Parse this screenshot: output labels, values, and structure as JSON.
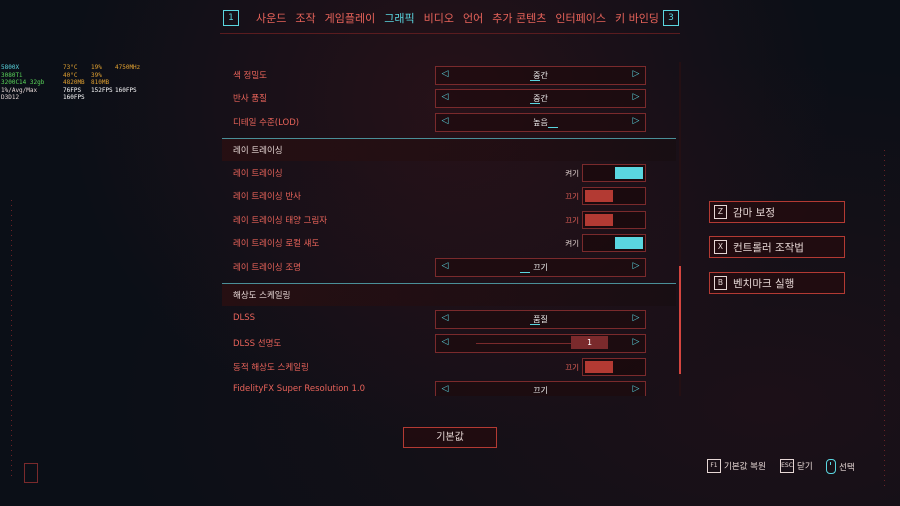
{
  "nav": {
    "left_key": "1",
    "right_key": "3",
    "tabs": [
      "사운드",
      "조작",
      "게임플레이",
      "그래픽",
      "비디오",
      "언어",
      "추가 콘텐츠",
      "인터페이스",
      "키 바인딩"
    ],
    "active_tab": "그래픽"
  },
  "perf_overlay": [
    [
      "5800X",
      "73°C",
      "19%",
      "4750MHz"
    ],
    [
      "3080Ti",
      "40°C",
      "39%",
      ""
    ],
    [
      "3200C14 32gb",
      "4820MB",
      "810MB",
      ""
    ],
    [
      "1%/Avg/Max",
      "76FPS",
      "152FPS",
      "160FPS"
    ],
    [
      "D3D12",
      "160FPS",
      "",
      ""
    ]
  ],
  "settings": {
    "color_precision": {
      "label": "색 정밀도",
      "value": "중간"
    },
    "reflection_quality": {
      "label": "반사 품질",
      "value": "중간"
    },
    "lod": {
      "label": "디테일 수준(LOD)",
      "value": "높음"
    },
    "rt_section": "레이 트레이싱",
    "rt": {
      "label": "레이 트레이싱",
      "state": "켜기"
    },
    "rt_reflections": {
      "label": "레이 트레이싱 반사",
      "state": "끄기"
    },
    "rt_sun_shadows": {
      "label": "레이 트레이싱 태양 그림자",
      "state": "끄기"
    },
    "rt_local_shadows": {
      "label": "레이 트레이싱 로컬 섀도",
      "state": "켜기"
    },
    "rt_lighting": {
      "label": "레이 트레이싱 조명",
      "value": "끄기"
    },
    "scaling_section": "해상도 스케일링",
    "dlss": {
      "label": "DLSS",
      "value": "품질"
    },
    "dlss_sharpness": {
      "label": "DLSS 선명도",
      "value": "1"
    },
    "dynamic_scaling": {
      "label": "동적 해상도 스케일링",
      "state": "끄기"
    },
    "fsr": {
      "label": "FidelityFX Super Resolution 1.0",
      "value": "끄기"
    }
  },
  "side_buttons": [
    {
      "key": "Z",
      "label": "감마 보정"
    },
    {
      "key": "X",
      "label": "컨트롤러 조작법"
    },
    {
      "key": "B",
      "label": "벤치마크 실행"
    }
  ],
  "default_button": "기본값",
  "hints": {
    "reset_key": "F1",
    "reset_label": "기본값 복원",
    "close_key": "ESC",
    "close_label": "닫기",
    "select_label": "선택"
  },
  "colors": {
    "accent_cyan": "#5ad6e0",
    "accent_red": "#e8635a",
    "toggle_off": "#b33a33",
    "background": "#0b0f17"
  }
}
